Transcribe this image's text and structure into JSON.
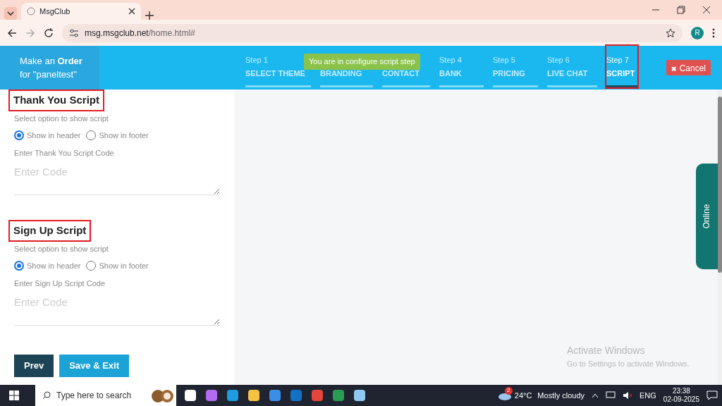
{
  "browser": {
    "tab_title": "MsgClub",
    "url_host": "msg.msgclub.net",
    "url_path": "/home.html#",
    "profile_initial": "R"
  },
  "header": {
    "line1_prefix": "Make an ",
    "line1_bold": "Order",
    "line2": "for \"paneltest\"",
    "steps": [
      {
        "step": "Step 1",
        "label": "SELECT THEME",
        "selected": false,
        "highlighted": false
      },
      {
        "label": "BRANDING",
        "selected": false,
        "highlighted": false
      },
      {
        "label": "CONTACT",
        "selected": false,
        "highlighted": false
      },
      {
        "step": "Step 4",
        "label": "BANK",
        "selected": false,
        "highlighted": false
      },
      {
        "step": "Step 5",
        "label": "PRICING",
        "selected": false,
        "highlighted": false
      },
      {
        "step": "Step 6",
        "label": "LIVE CHAT",
        "selected": false,
        "highlighted": false
      },
      {
        "step": "Step 7",
        "label": "SCRIPT",
        "selected": true,
        "highlighted": true
      }
    ],
    "tooltip": "You are in configure script step",
    "cancel_icon": "✖",
    "cancel": "Cancel"
  },
  "sections": [
    {
      "title": "Thank You Script",
      "highlighted": true,
      "prompt": "Select option to show script",
      "options": [
        {
          "label": "Show in header",
          "selected": true
        },
        {
          "label": "Show in footer",
          "selected": false
        }
      ],
      "code_label": "Enter Thank You Script Code",
      "placeholder": "Enter Code"
    },
    {
      "title": "Sign Up Script",
      "highlighted": true,
      "prompt": "Select option to show script",
      "options": [
        {
          "label": "Show in header",
          "selected": true
        },
        {
          "label": "Show in footer",
          "selected": false
        }
      ],
      "code_label": "Enter Sign Up Script Code",
      "placeholder": "Enter Code"
    }
  ],
  "buttons": [
    {
      "label": "Prev",
      "kind": "dark"
    },
    {
      "label": "Save & Exit",
      "kind": "primary"
    }
  ],
  "online_tab": "Online",
  "activation": {
    "title": "Activate Windows",
    "text": "Go to Settings to activate Windows."
  },
  "taskbar": {
    "search_placeholder": "Type here to search",
    "weather_badge": "2",
    "weather": "24°C",
    "weather_text": "Mostly cloudy",
    "language": "ENG",
    "time": "23:38",
    "date": "02-09-2025"
  }
}
